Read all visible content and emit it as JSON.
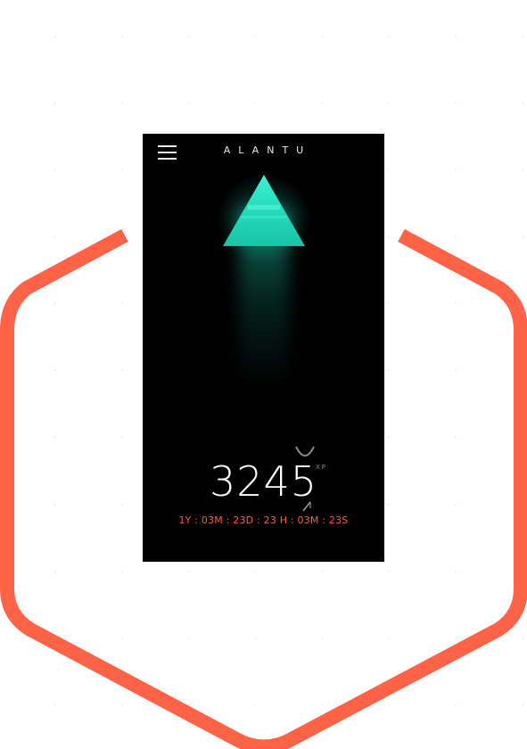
{
  "app": {
    "brand": "ALANTU"
  },
  "stats": {
    "xp_value": "3245",
    "xp_unit": "XP",
    "countdown": "1Y : 03M : 23D : 23 H : 03M : 23S"
  },
  "icons": {
    "menu": "hamburger-menu-icon",
    "pyramid": "pyramid-icon",
    "dial": "dial-icon",
    "marker": "slash-marker-icon"
  },
  "colors": {
    "frame_accent": "#FF6347",
    "screen_background": "#000000",
    "pyramid_glow": "#2EE6C8",
    "countdown_text": "#FF5C3D",
    "primary_text": "#FFFFFF"
  }
}
